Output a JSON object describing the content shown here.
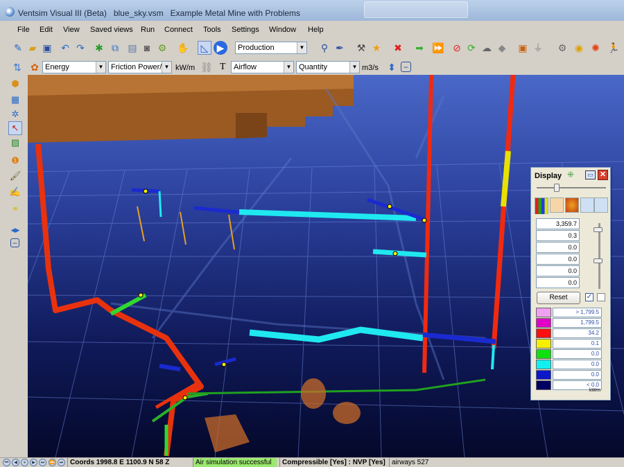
{
  "window": {
    "title": "Ventsim Visual III (Beta)   blue_sky.vsm   Example Metal Mine with Problems"
  },
  "menu": [
    "File",
    "Edit",
    "View",
    "Saved views",
    "Run",
    "Connect",
    "Tools",
    "Settings",
    "Window",
    "Help"
  ],
  "toolbar1": {
    "scenario_combo": "Production"
  },
  "toolbar2": {
    "data_type_combo": "Energy",
    "data_item_combo": "Friction Power/L",
    "unit_label": "kW/m",
    "text_label": "T",
    "text_type_combo": "Airflow",
    "text_item_combo": "Quantity",
    "text_unit_label": "m3/s"
  },
  "display_panel": {
    "title": "Display",
    "values": [
      "3,359.7",
      "0.3",
      "0.0",
      "0.0",
      "0.0",
      "0.0"
    ],
    "reset_label": "Reset",
    "checkbox_checked": true,
    "legend": [
      {
        "label": "> 1,799.5",
        "color": "#f0a0f0"
      },
      {
        "label": "1,799.5",
        "color": "#e000c8"
      },
      {
        "label": "34.2",
        "color": "#ff1010"
      },
      {
        "label": "0.1",
        "color": "#f8f000"
      },
      {
        "label": "0.0",
        "color": "#10e010"
      },
      {
        "label": "0.0",
        "color": "#10f0f0"
      },
      {
        "label": "0.0",
        "color": "#0a18c8"
      },
      {
        "label": "< 0.0",
        "color": "#000060"
      }
    ],
    "unit": "kWm"
  },
  "status": {
    "coords": "Coords 1998.8 E     1100.9 N     58 Z",
    "simulation": "Air simulation successful",
    "compressible": "Compressible [Yes] : NVP [Yes]",
    "airways": "airways 527"
  },
  "colors": {
    "accent": "#316ac5",
    "pipe_red": "#f02a10",
    "pipe_cyan": "#20e8f0",
    "pipe_blue": "#1428c8",
    "pipe_green": "#30d830",
    "pipe_yellow": "#e8e000",
    "ore_body": "#9a5a22",
    "viewport_bg_top": "#3a55b8",
    "viewport_bg_bottom": "#050a30"
  }
}
